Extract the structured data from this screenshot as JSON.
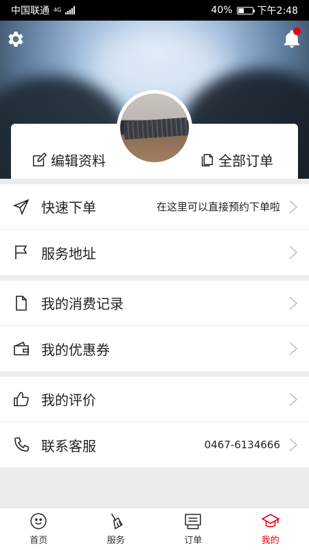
{
  "status_bar": {
    "carrier": "中国联通",
    "network": "4G",
    "battery": "40%",
    "battery_level": 0.4,
    "time": "下午2:48"
  },
  "header": {
    "edit_profile_label": "编辑资料",
    "all_orders_label": "全部订单",
    "has_notification": true
  },
  "menu": {
    "groups": [
      [
        {
          "label": "快速下单",
          "value": "在这里可以直接预约下单啦",
          "icon": "send-icon"
        },
        {
          "label": "服务地址",
          "value": "",
          "icon": "flag-icon"
        }
      ],
      [
        {
          "label": "我的消费记录",
          "value": "",
          "icon": "document-icon"
        },
        {
          "label": "我的优惠券",
          "value": "",
          "icon": "wallet-icon"
        }
      ],
      [
        {
          "label": "我的评价",
          "value": "",
          "icon": "thumbs-up-icon"
        },
        {
          "label": "联系客服",
          "value": "0467-6134666",
          "icon": "phone-icon"
        }
      ]
    ]
  },
  "tabs": [
    {
      "label": "首页",
      "icon": "smiley-icon",
      "active": false
    },
    {
      "label": "服务",
      "icon": "broom-icon",
      "active": false
    },
    {
      "label": "订单",
      "icon": "order-list-icon",
      "active": false
    },
    {
      "label": "我的",
      "icon": "graduation-cap-icon",
      "active": true
    }
  ],
  "colors": {
    "accent": "#e60012",
    "text": "#222222",
    "background": "#ececec"
  }
}
